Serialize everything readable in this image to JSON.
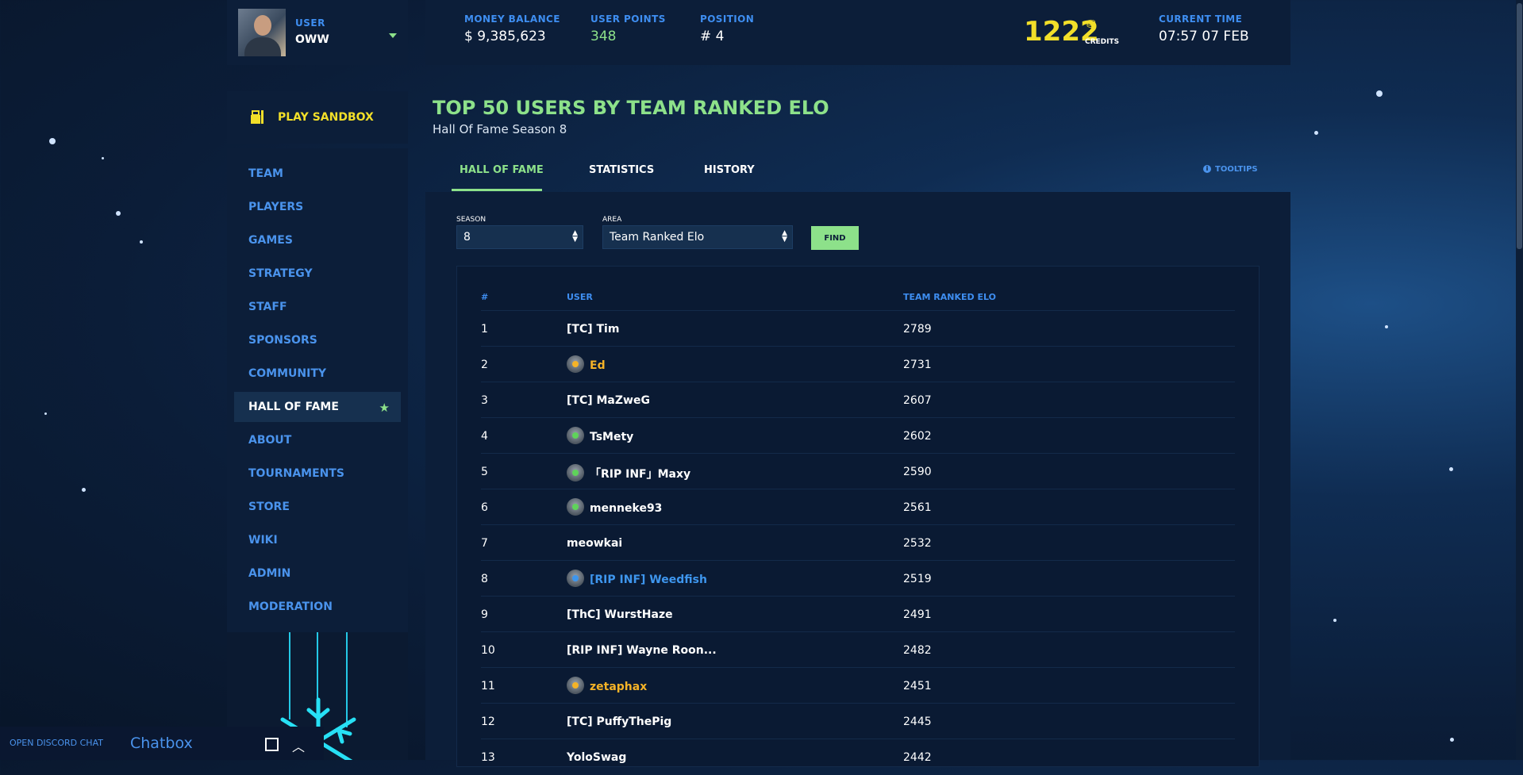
{
  "user": {
    "label": "USER",
    "name": "OWW"
  },
  "sandbox": {
    "label": "PLAY SANDBOX"
  },
  "nav": {
    "items": [
      {
        "label": "TEAM"
      },
      {
        "label": "PLAYERS"
      },
      {
        "label": "GAMES"
      },
      {
        "label": "STRATEGY"
      },
      {
        "label": "STAFF"
      },
      {
        "label": "SPONSORS"
      },
      {
        "label": "COMMUNITY"
      },
      {
        "label": "HALL OF FAME"
      },
      {
        "label": "ABOUT"
      },
      {
        "label": "TOURNAMENTS"
      },
      {
        "label": "STORE"
      },
      {
        "label": "WIKI"
      },
      {
        "label": "ADMIN"
      },
      {
        "label": "MODERATION"
      }
    ],
    "active_index": 7
  },
  "chat": {
    "discord_label": "OPEN DISCORD CHAT",
    "title": "Chatbox"
  },
  "stats": {
    "money_label": "MONEY BALANCE",
    "money_value": "$ 9,385,623",
    "points_label": "USER POINTS",
    "points_value": "348",
    "position_label": "POSITION",
    "position_value": "# 4",
    "credits_value": "1222",
    "credits_label": "CREDITS",
    "time_label": "CURRENT TIME",
    "time_value": "07:57 07 FEB"
  },
  "page": {
    "title": "TOP 50 USERS BY TEAM RANKED ELO",
    "subtitle": "Hall Of Fame Season 8"
  },
  "tabs": [
    {
      "label": "HALL OF FAME"
    },
    {
      "label": "STATISTICS"
    },
    {
      "label": "HISTORY"
    }
  ],
  "tooltips_label": "TOOLTIPS",
  "filters": {
    "season_label": "SEASON",
    "season_value": "8",
    "area_label": "AREA",
    "area_value": "Team Ranked Elo",
    "find_label": "FIND"
  },
  "table": {
    "headers": [
      "#",
      "USER",
      "TEAM RANKED ELO"
    ],
    "rows": [
      {
        "rank": "1",
        "user": "[TC] Tim",
        "elo": "2789",
        "badge": "",
        "style": ""
      },
      {
        "rank": "2",
        "user": "Ed",
        "elo": "2731",
        "badge": "gold",
        "style": "gold"
      },
      {
        "rank": "3",
        "user": "[TC] MaZweG",
        "elo": "2607",
        "badge": "",
        "style": ""
      },
      {
        "rank": "4",
        "user": "TsMety",
        "elo": "2602",
        "badge": "green",
        "style": ""
      },
      {
        "rank": "5",
        "user": "「RIP INF」Maxy",
        "elo": "2590",
        "badge": "green",
        "style": ""
      },
      {
        "rank": "6",
        "user": "menneke93",
        "elo": "2561",
        "badge": "green",
        "style": ""
      },
      {
        "rank": "7",
        "user": "meowkai",
        "elo": "2532",
        "badge": "",
        "style": ""
      },
      {
        "rank": "8",
        "user": "[RIP INF] Weedfish",
        "elo": "2519",
        "badge": "blue",
        "style": "blue"
      },
      {
        "rank": "9",
        "user": "[ThC] WurstHaze",
        "elo": "2491",
        "badge": "",
        "style": ""
      },
      {
        "rank": "10",
        "user": "[RIP INF] Wayne Roon...",
        "elo": "2482",
        "badge": "",
        "style": ""
      },
      {
        "rank": "11",
        "user": "zetaphax",
        "elo": "2451",
        "badge": "gold",
        "style": "gold"
      },
      {
        "rank": "12",
        "user": "[TC] PuffyThePig",
        "elo": "2445",
        "badge": "",
        "style": ""
      },
      {
        "rank": "13",
        "user": "YoloSwag",
        "elo": "2442",
        "badge": "",
        "style": ""
      }
    ]
  },
  "colors": {
    "accent_green": "#8de18a",
    "accent_blue": "#3e8ef1",
    "credits_yellow": "#f2df29",
    "gold_user": "#f5b327"
  }
}
